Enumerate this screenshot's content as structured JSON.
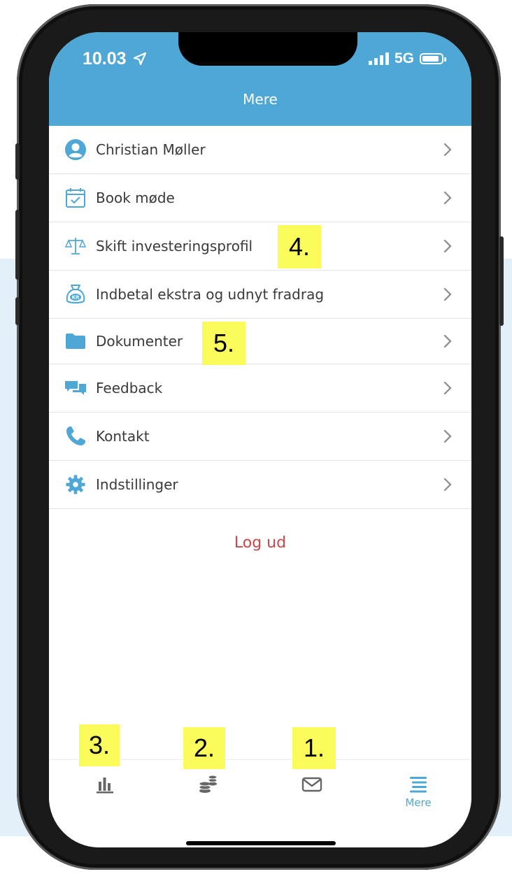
{
  "status_bar": {
    "time": "10.03",
    "network": "5G"
  },
  "header": {
    "title": "Mere"
  },
  "menu": {
    "items": [
      {
        "label": "Christian Møller",
        "icon": "user-avatar-icon"
      },
      {
        "label": "Book møde",
        "icon": "calendar-check-icon"
      },
      {
        "label": "Skift investeringsprofil",
        "icon": "balance-scale-icon"
      },
      {
        "label": "Indbetal ekstra og udnyt fradrag",
        "icon": "money-bag-kr-icon"
      },
      {
        "label": "Dokumenter",
        "icon": "folder-icon"
      },
      {
        "label": "Feedback",
        "icon": "chat-bubbles-icon"
      },
      {
        "label": "Kontakt",
        "icon": "phone-icon"
      },
      {
        "label": "Indstillinger",
        "icon": "gear-icon"
      }
    ]
  },
  "logout_label": "Log ud",
  "tabbar": {
    "tabs": [
      {
        "icon": "bar-chart-icon"
      },
      {
        "icon": "coins-icon"
      },
      {
        "icon": "envelope-icon"
      },
      {
        "icon": "menu-list-icon",
        "label": "Mere"
      }
    ]
  },
  "annotations": {
    "a1": "1.",
    "a2": "2.",
    "a3": "3.",
    "a4": "4.",
    "a5": "5."
  },
  "colors": {
    "primary": "#4fa7d6",
    "logout": "#c94848",
    "callout": "#fbfb5b"
  }
}
